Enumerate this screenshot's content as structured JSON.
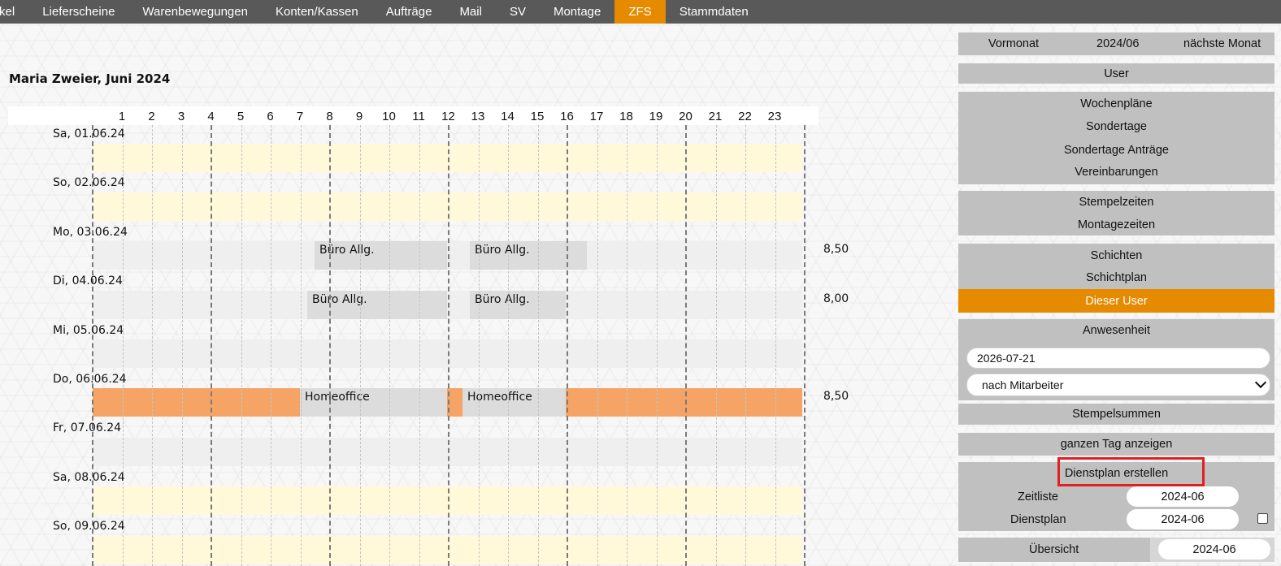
{
  "nav": {
    "items": [
      "kel",
      "Lieferscheine",
      "Warenbewegungen",
      "Konten/Kassen",
      "Aufträge",
      "Mail",
      "SV",
      "Montage",
      "ZFS",
      "Stammdaten"
    ],
    "active": "ZFS"
  },
  "title": "Maria Zweier, Juni 2024",
  "hours": [
    "1",
    "2",
    "3",
    "4",
    "5",
    "6",
    "7",
    "8",
    "9",
    "10",
    "11",
    "12",
    "13",
    "14",
    "15",
    "16",
    "17",
    "18",
    "19",
    "20",
    "21",
    "22",
    "23"
  ],
  "days": [
    {
      "label": "Sa, 01.06.24",
      "type": "weekend",
      "blocks": [],
      "total": ""
    },
    {
      "label": "So, 02.06.24",
      "type": "weekend",
      "blocks": [],
      "total": ""
    },
    {
      "label": "Mo, 03.06.24",
      "type": "weekday",
      "blocks": [
        "Büro Allg.",
        "Büro Allg."
      ],
      "total": "8,50"
    },
    {
      "label": "Di, 04.06.24",
      "type": "weekday",
      "blocks": [
        "Büro Allg.",
        "Büro Allg."
      ],
      "total": "8,00"
    },
    {
      "label": "Mi, 05.06.24",
      "type": "weekday",
      "blocks": [],
      "total": ""
    },
    {
      "label": "Do, 06.06.24",
      "type": "orange",
      "blocks": [
        "Homeoffice",
        "Homeoffice"
      ],
      "total": "8,50"
    },
    {
      "label": "Fr, 07.06.24",
      "type": "weekday",
      "blocks": [],
      "total": ""
    },
    {
      "label": "Sa, 08.06.24",
      "type": "weekend",
      "blocks": [],
      "total": ""
    },
    {
      "label": "So, 09.06.24",
      "type": "weekend",
      "blocks": [],
      "total": ""
    }
  ],
  "sidebar": {
    "prev_month": "Vormonat",
    "current_month": "2024/06",
    "next_month": "nächste Monat",
    "user": "User",
    "wochenplaene": "Wochenpläne",
    "sondertage": "Sondertage",
    "sondertage_antraege": "Sondertage Anträge",
    "vereinbarungen": "Vereinbarungen",
    "stempelzeiten": "Stempelzeiten",
    "montagezeiten": "Montagezeiten",
    "schichten": "Schichten",
    "schichtplan": "Schichtplan",
    "dieser_user": "Dieser User",
    "anwesenheit": "Anwesenheit",
    "date_value": "2026-07-21",
    "select_value": "nach Mitarbeiter",
    "stempelsummen": "Stempelsummen",
    "ganzen_tag": "ganzen Tag anzeigen",
    "dienstplan_erstellen": "Dienstplan erstellen",
    "zeitliste_label": "Zeitliste",
    "zeitliste_value": "2024-06",
    "dienstplan_label": "Dienstplan",
    "dienstplan_value": "2024-06",
    "uebersicht_label": "Übersicht",
    "uebersicht_value": "2024-06"
  }
}
